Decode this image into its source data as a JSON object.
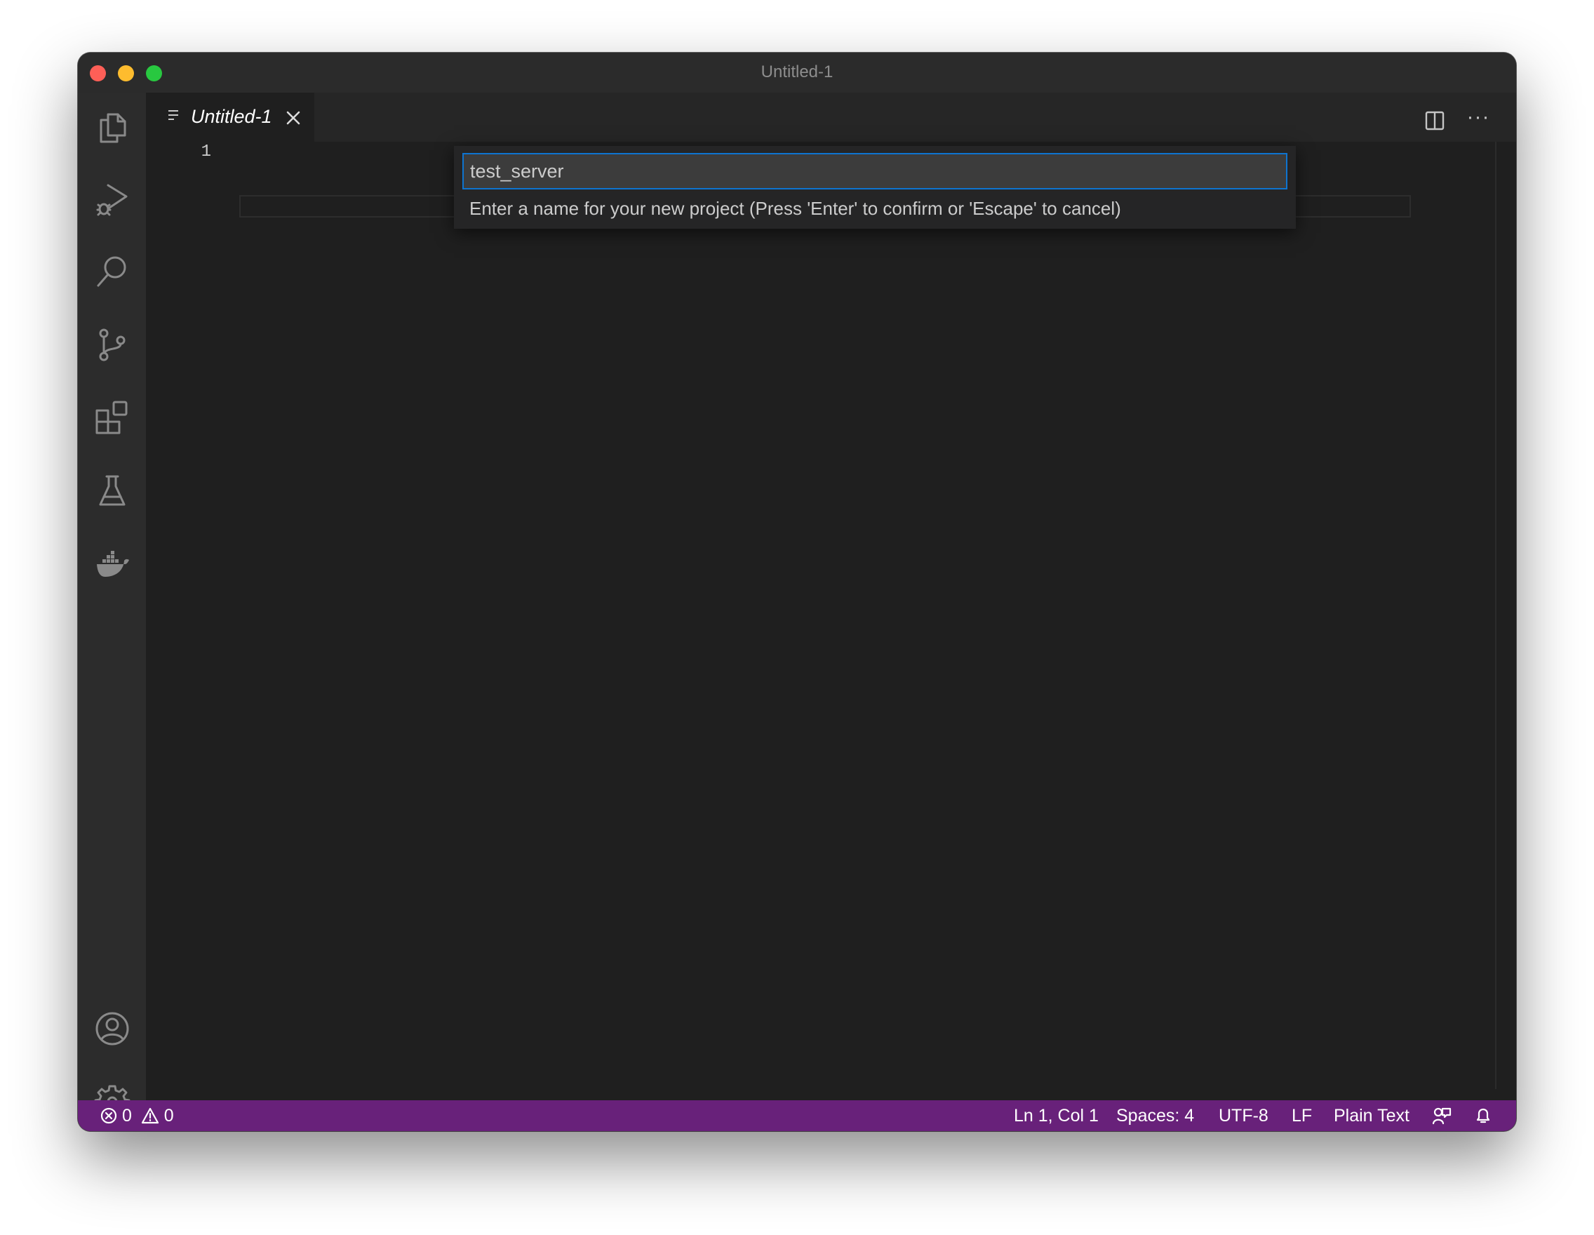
{
  "window": {
    "title": "Untitled-1",
    "controls": [
      "close",
      "minimize",
      "zoom"
    ]
  },
  "activity_bar": {
    "top_items": [
      {
        "name": "explorer",
        "icon": "files-icon"
      },
      {
        "name": "run-and-debug",
        "icon": "run-debug-icon"
      },
      {
        "name": "search",
        "icon": "search-icon"
      },
      {
        "name": "source-control",
        "icon": "source-control-icon"
      },
      {
        "name": "extensions",
        "icon": "extensions-icon"
      },
      {
        "name": "testing",
        "icon": "flask-icon"
      },
      {
        "name": "docker",
        "icon": "docker-whale-icon"
      }
    ],
    "bottom_items": [
      {
        "name": "accounts",
        "icon": "account-icon"
      },
      {
        "name": "manage",
        "icon": "gear-icon"
      }
    ]
  },
  "tabs": [
    {
      "label": "Untitled-1",
      "icon": "text-file-icon",
      "active": true
    }
  ],
  "editor": {
    "line_numbers": [
      "1"
    ]
  },
  "quick_input": {
    "value": "test_server",
    "message": "Enter a name for your new project (Press 'Enter' to confirm or 'Escape' to cancel)"
  },
  "status_bar": {
    "errors": "0",
    "warnings": "0",
    "position": "Ln 1, Col 1",
    "indentation": "Spaces: 4",
    "encoding": "UTF-8",
    "eol": "LF",
    "language": "Plain Text"
  },
  "colors": {
    "status_bar": "#68217a",
    "focus_border": "#0e74d0",
    "editor_background": "#1f1f1f",
    "activity_bar": "#2c2c2c"
  }
}
